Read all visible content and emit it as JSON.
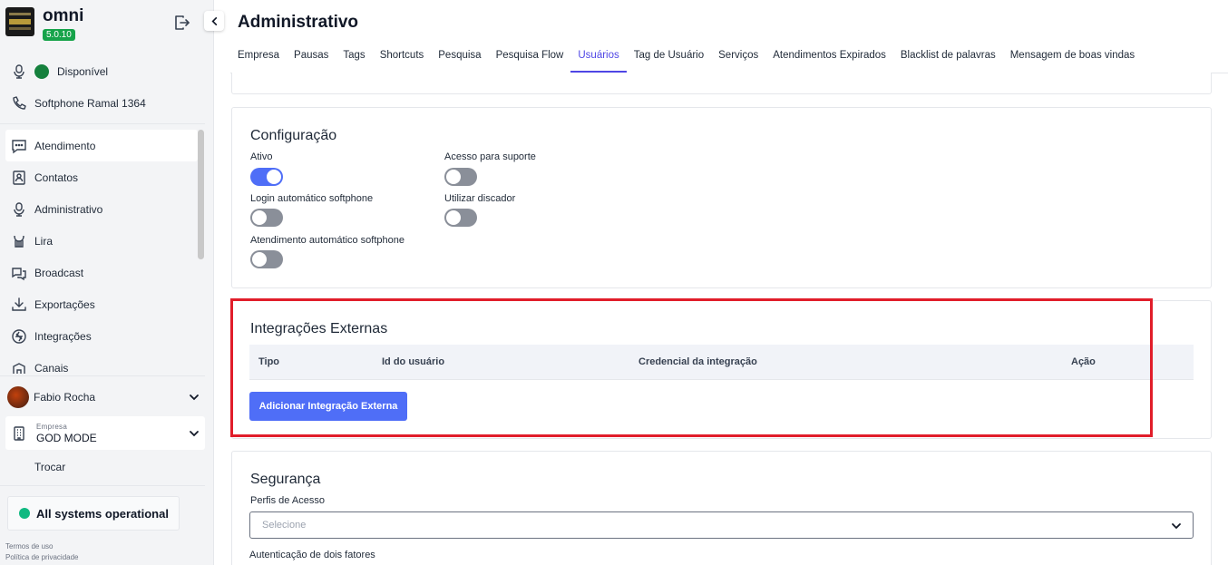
{
  "brand": {
    "name": "omni",
    "version": "5.0.10"
  },
  "status": {
    "availability": "Disponível",
    "softphone": "Softphone Ramal 1364"
  },
  "menu": [
    {
      "label": "Atendimento",
      "icon": "chat-icon"
    },
    {
      "label": "Contatos",
      "icon": "contacts-icon"
    },
    {
      "label": "Administrativo",
      "icon": "admin-icon"
    },
    {
      "label": "Lira",
      "icon": "lira-icon"
    },
    {
      "label": "Broadcast",
      "icon": "broadcast-icon"
    },
    {
      "label": "Exportações",
      "icon": "download-icon"
    },
    {
      "label": "Integrações",
      "icon": "integrations-icon"
    },
    {
      "label": "Canais",
      "icon": "channels-icon"
    }
  ],
  "user": {
    "name": "Fabio Rocha"
  },
  "company": {
    "label": "Empresa",
    "value": "GOD MODE",
    "switch_label": "Trocar"
  },
  "system_status": "All systems operational",
  "legal": {
    "terms": "Termos de uso",
    "privacy": "Política de privacidade"
  },
  "page": {
    "title": "Administrativo"
  },
  "tabs": [
    "Empresa",
    "Pausas",
    "Tags",
    "Shortcuts",
    "Pesquisa",
    "Pesquisa Flow",
    "Usuários",
    "Tag de Usuário",
    "Serviços",
    "Atendimentos Expirados",
    "Blacklist de palavras",
    "Mensagem de boas vindas"
  ],
  "active_tab": "Usuários",
  "config": {
    "title": "Configuração",
    "fields": [
      {
        "label": "Ativo",
        "on": true
      },
      {
        "label": "Acesso para suporte",
        "on": false
      },
      {
        "label": "Login automático softphone",
        "on": false
      },
      {
        "label": "Utilizar discador",
        "on": false
      },
      {
        "label": "Atendimento automático softphone",
        "on": false
      }
    ]
  },
  "integrations": {
    "title": "Integrações Externas",
    "columns": [
      "Tipo",
      "Id do usuário",
      "Credencial da integração",
      "Ação"
    ],
    "add_label": "Adicionar Integração Externa"
  },
  "security": {
    "title": "Segurança",
    "profiles_label": "Perfis de Acesso",
    "profiles_placeholder": "Selecione",
    "next_label": "Autenticação de dois fatores"
  },
  "colors": {
    "accent": "#4f6ef7",
    "active_tab": "#4f46e5",
    "highlight": "#e11d2a",
    "status_green": "#15803d",
    "version_badge": "#16a34a"
  }
}
